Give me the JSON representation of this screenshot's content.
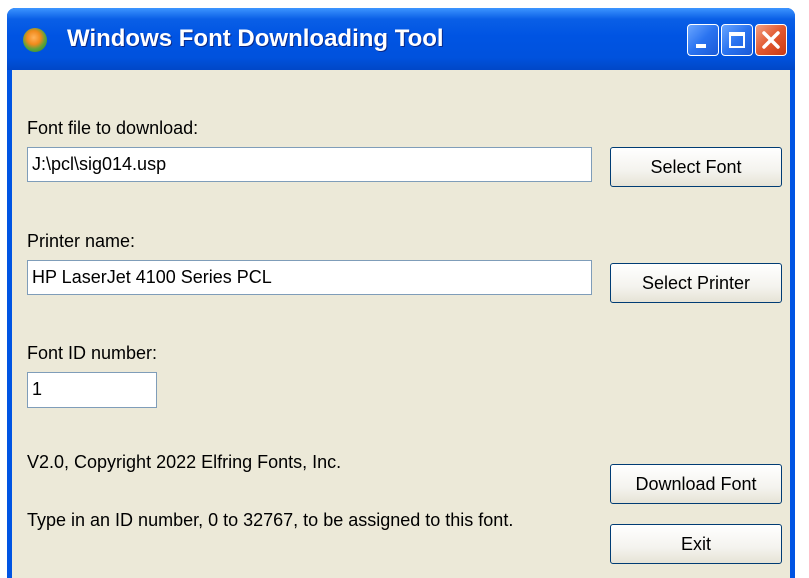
{
  "window": {
    "title": "Windows Font Downloading Tool",
    "accent_color": "#0054e3",
    "controls": {
      "minimize_icon": "minimize-icon",
      "maximize_icon": "maximize-icon",
      "close_icon": "close-icon"
    }
  },
  "font_file": {
    "label": "Font file to download:",
    "value": "J:\\pcl\\sig014.usp",
    "button_label": "Select Font"
  },
  "printer": {
    "label": "Printer name:",
    "value": "HP LaserJet 4100 Series PCL",
    "button_label": "Select Printer"
  },
  "font_id": {
    "label": "Font ID number:",
    "value": "1"
  },
  "version_text": "V2.0, Copyright 2022 Elfring Fonts, Inc.",
  "help_text": "Type in an ID number, 0 to 32767, to be assigned to this font.",
  "actions": {
    "download_label": "Download Font",
    "exit_label": "Exit"
  }
}
